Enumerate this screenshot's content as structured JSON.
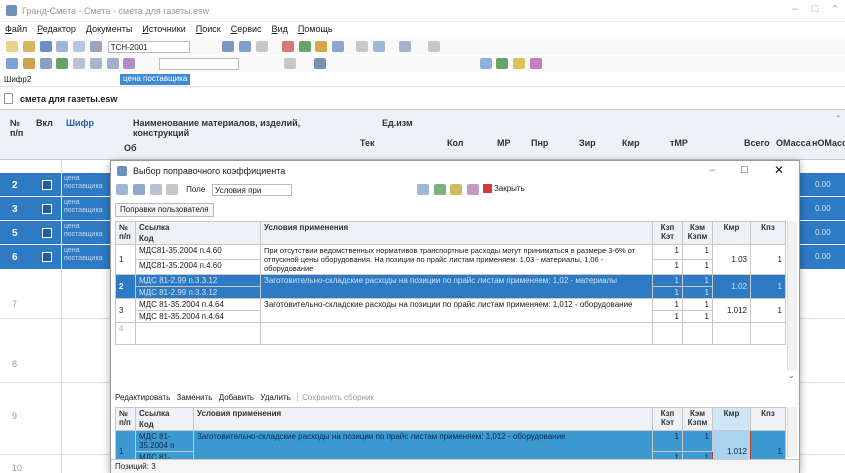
{
  "window": {
    "title": "Гранд-Смета - Смета - смета для газеты.esw"
  },
  "menu": [
    "Файл",
    "Редактор",
    "Документы",
    "Источники",
    "Поиск",
    "Сервис",
    "Вид",
    "Помощь"
  ],
  "toolbar": {
    "normative_base": "ТСН-2001"
  },
  "name_box": {
    "cell_ref": "Шифр2",
    "value": "цена поставщика"
  },
  "doc_tab": {
    "label": "смета для газеты.esw"
  },
  "grid": {
    "headers": {
      "num": "№ п/п",
      "vkl": "Вкл",
      "shifr": "Шифр",
      "name": "Наименование материалов, изделий, конструкций",
      "ob": "Об",
      "unit": "Ед.изм",
      "tek": "Тек",
      "kol": "Кол",
      "mr": "МР",
      "pnr": "Пнр",
      "zr": "Зир",
      "kmr": "Кмр",
      "tmr": "тМР",
      "vsego": "Всего",
      "omassa": "ОМасса",
      "nomassa": "нОМасса"
    },
    "rows": [
      {
        "n": "2",
        "shifr": "цена поставщика",
        "total": "0.00"
      },
      {
        "n": "3",
        "shifr": "цена поставщика",
        "total": "0.00"
      },
      {
        "n": "5",
        "shifr": "цена поставщика",
        "total": "0.00"
      },
      {
        "n": "6",
        "shifr": "цена поставщика",
        "total": "0.00"
      }
    ],
    "empty_rows": [
      "7",
      "8",
      "9",
      "10"
    ]
  },
  "dialog": {
    "title": "Выбор поправочного коэффициента",
    "field_label": "Поле",
    "field_value": "Условия при",
    "close_label": "Закрыть",
    "tab": "Поправки пользователя",
    "columns": {
      "num": "№ п/п",
      "link": "Ссылка",
      "code": "Код",
      "cond": "Условия применения",
      "kzp": "Кзп",
      "kst": "Кэт",
      "kem": "Кэм",
      "kzpm": "Кзпм",
      "kmr": "Кмр",
      "kz": "Кпз"
    },
    "rows": [
      {
        "n": "1",
        "link": "МДС81-35.2004 п.4.60",
        "code": "МДС81-35.2004 п.4.60",
        "cond": "При отсутствии ведомственных нормативов транспортные расходы могут приниматься в размере 3-6% от отпускной цены оборудования. На позиции по прайс листам применяем: 1,03 - материалы, 1,06 - оборудование",
        "a": "1",
        "b": "1",
        "c": "1",
        "d": "1",
        "kmr": "1.03",
        "kz": "1"
      },
      {
        "n": "2",
        "link": "МДС 81-2.99 п.3.3.12",
        "code": "МДС 81-2.99 п.3.3.12",
        "cond": "Заготовительно-складские расходы на позиции по прайс листам применяем: 1,02 - материалы",
        "a": "1",
        "b": "1",
        "c": "1",
        "d": "1",
        "kmr": "1.02",
        "kz": "1"
      },
      {
        "n": "3",
        "link": "МДС 81-35.2004 п.4.64",
        "code": "МДС 81-35.2004 п.4.64",
        "cond": "Заготовительно-складские расходы на позиции по прайс листам применяем: 1,012 - оборудование",
        "a": "1",
        "b": "1",
        "c": "1",
        "d": "1",
        "kmr": "1.012",
        "kz": "1"
      },
      {
        "n": "4",
        "link": "",
        "code": "",
        "cond": "",
        "a": "",
        "b": "",
        "c": "",
        "d": "",
        "kmr": "",
        "kz": ""
      }
    ],
    "actions": [
      "Редактировать",
      "Заменить",
      "Добавить",
      "Удалить",
      "Сохранить сборник"
    ],
    "bottom_row": {
      "n": "1",
      "link": "МДС 81-35.2004 п",
      "code": "МДС 81-35.2004 п",
      "cond": "Заготовительно-складские расходы на позиции по прайс листам применяем: 1,012 - оборудование",
      "a": "1",
      "b": "1",
      "c": "1",
      "d": "1",
      "kmr": "1.012",
      "kz": "1"
    },
    "status": "Позиций: 3"
  }
}
